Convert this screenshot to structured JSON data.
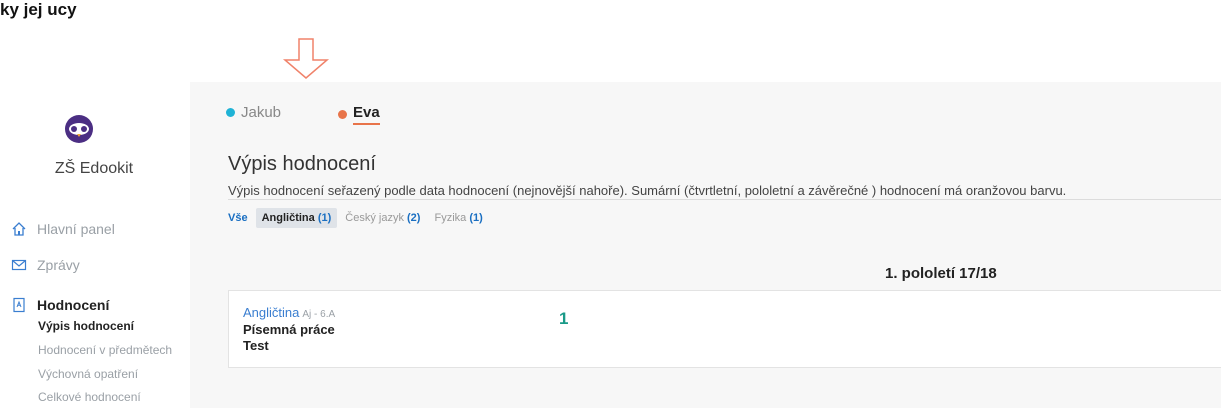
{
  "caption": "ky jej ucy",
  "sidebar": {
    "school_name": "ZŠ Edookit",
    "nav": [
      {
        "label": "Hlavní panel",
        "icon": "home-icon"
      },
      {
        "label": "Zprávy",
        "icon": "envelope-icon"
      },
      {
        "label": "Hodnocení",
        "icon": "grade-document-icon"
      }
    ],
    "sub_items": [
      {
        "label": "Výpis hodnocení"
      },
      {
        "label": "Hodnocení v předmětech"
      },
      {
        "label": "Výchovná opatření"
      },
      {
        "label": "Celkové hodnocení"
      }
    ]
  },
  "students": [
    {
      "name": "Jakub",
      "color": "#1fb3d6"
    },
    {
      "name": "Eva",
      "color": "#e8744a"
    }
  ],
  "page": {
    "title": "Výpis hodnocení",
    "description": "Výpis hodnocení seřazený podle data hodnocení (nejnovější nahoře). Sumární (čtvrtletní, pololetní a závěrečné ) hodnocení má oranžovou barvu."
  },
  "filters": [
    {
      "label": "Vše",
      "count": ""
    },
    {
      "label": "Angličtina",
      "count": "(1)"
    },
    {
      "label": "Český jazyk",
      "count": "(2)"
    },
    {
      "label": "Fyzika",
      "count": "(1)"
    }
  ],
  "period": "1. pololetí 17/18",
  "grade_card": {
    "subject": "Angličtina",
    "class_code": "Aj - 6.A",
    "work": "Písemná práce",
    "type": "Test",
    "grade": "1"
  },
  "colors": {
    "accent": "#e8744a",
    "link": "#3a7ed0",
    "grade": "#1a9a88",
    "arrow": "#f0826a"
  }
}
